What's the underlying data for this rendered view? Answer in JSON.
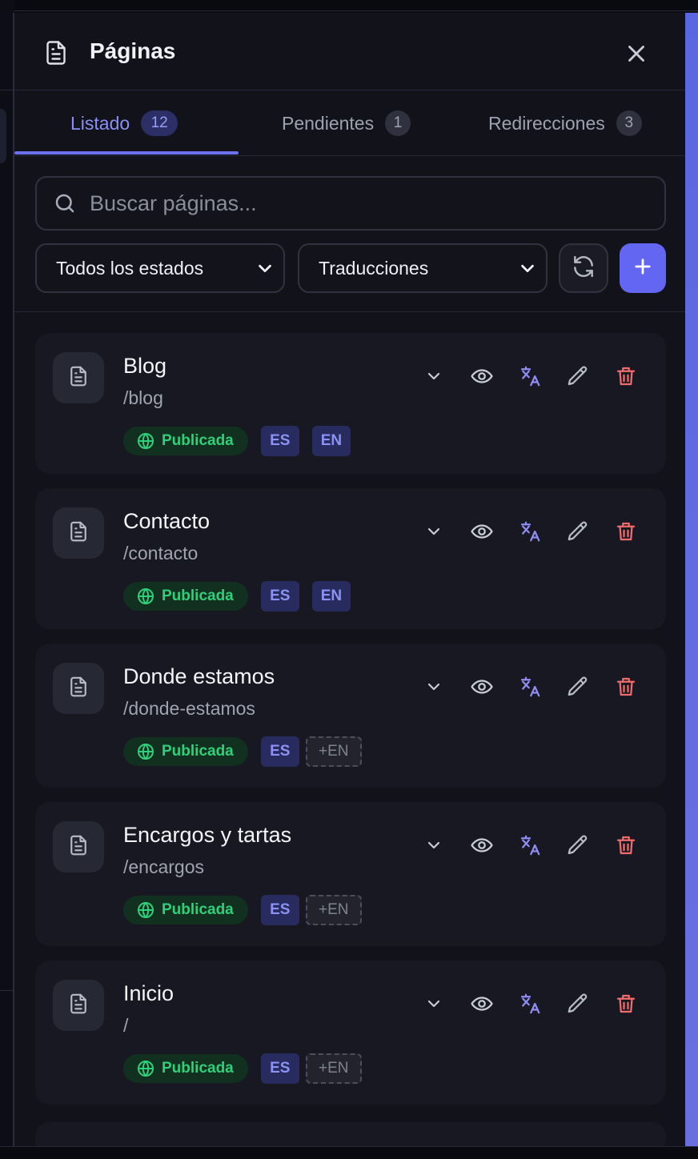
{
  "panel": {
    "title": "Páginas",
    "title_icon": "document-icon",
    "close_icon": "close-icon"
  },
  "tabs": [
    {
      "label": "Listado",
      "count": "12",
      "active": true
    },
    {
      "label": "Pendientes",
      "count": "1",
      "active": false
    },
    {
      "label": "Redirecciones",
      "count": "3",
      "active": false
    }
  ],
  "search": {
    "placeholder": "Buscar páginas...",
    "value": ""
  },
  "filters": {
    "status": "Todos los estados",
    "translations": "Traducciones",
    "refresh_icon": "refresh-icon",
    "add_icon": "plus-icon"
  },
  "pages": [
    {
      "name": "Blog",
      "slug": "/blog",
      "status": "Publicada",
      "langs": [
        {
          "code": "ES",
          "present": true
        },
        {
          "code": "EN",
          "present": true
        }
      ]
    },
    {
      "name": "Contacto",
      "slug": "/contacto",
      "status": "Publicada",
      "langs": [
        {
          "code": "ES",
          "present": true
        },
        {
          "code": "EN",
          "present": true
        }
      ]
    },
    {
      "name": "Donde estamos",
      "slug": "/donde-estamos",
      "status": "Publicada",
      "langs": [
        {
          "code": "ES",
          "present": true
        },
        {
          "code": "+EN",
          "present": false
        }
      ]
    },
    {
      "name": "Encargos y tartas",
      "slug": "/encargos",
      "status": "Publicada",
      "langs": [
        {
          "code": "ES",
          "present": true
        },
        {
          "code": "+EN",
          "present": false
        }
      ]
    },
    {
      "name": "Inicio",
      "slug": "/",
      "status": "Publicada",
      "langs": [
        {
          "code": "ES",
          "present": true
        },
        {
          "code": "+EN",
          "present": false
        }
      ]
    }
  ],
  "colors": {
    "accent": "#6366f1",
    "status_green": "#2fd07a",
    "danger": "#f06b6b",
    "lang_badge": "#8c92f2"
  }
}
